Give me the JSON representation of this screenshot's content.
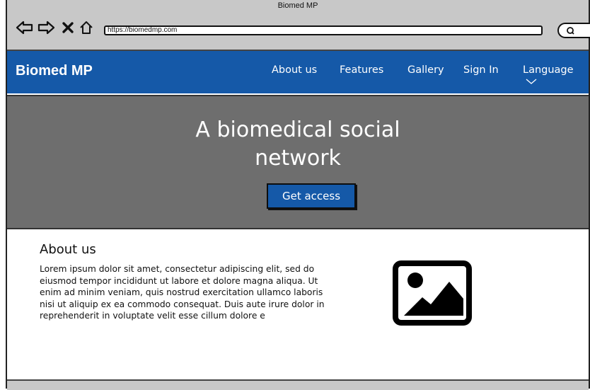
{
  "browser": {
    "title": "Biomed MP",
    "url": "https://biomedmp.com",
    "buttons": [
      "back-icon",
      "forward-icon",
      "stop-icon",
      "home-icon",
      "search-icon"
    ]
  },
  "header": {
    "brand": "Biomed MP",
    "nav": {
      "about": "About us",
      "features": "Features",
      "gallery": "Gallery",
      "signin": "Sign In",
      "language": "Language"
    },
    "accent_color": "#1559a8"
  },
  "hero": {
    "title_line1": "A biomedical social",
    "title_line2": "network",
    "cta_label": "Get access"
  },
  "about": {
    "heading": "About us",
    "body": "Lorem ipsum dolor sit amet, consectetur adipiscing elit, sed do eiusmod tempor incididunt ut labore et dolore magna aliqua. Ut enim ad minim veniam, quis nostrud exercitation ullamco laboris nisi ut aliquip ex ea commodo consequat. Duis aute irure dolor in reprehenderit in voluptate velit esse cillum dolore e",
    "image_icon": "image-icon"
  }
}
